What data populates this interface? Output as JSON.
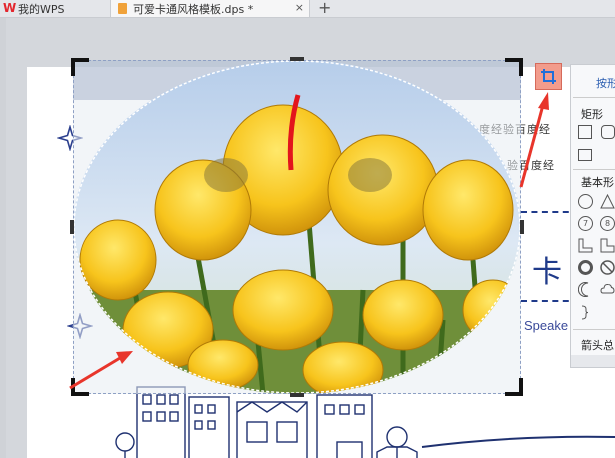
{
  "tabs": {
    "home_label": "我的WPS",
    "doc_label": "可爱卡通风格模板.dps *",
    "close_symbol": "×",
    "add_symbol": "+"
  },
  "slide": {
    "deco_line_1": "度经验百度经",
    "deco_line_2": "验百度经",
    "big_char": "卡",
    "speaker_text": "Speake"
  },
  "panel": {
    "title": "按形",
    "section_rect": "矩形",
    "section_basic": "基本形",
    "section_arrow": "箭头总"
  },
  "colors": {
    "accent_red": "#e8352b",
    "crop_button_bg": "#f29c8c",
    "panel_link": "#2a5db0"
  },
  "icons": [
    "wps-logo-icon",
    "document-icon",
    "crop-icon",
    "star-icon"
  ]
}
